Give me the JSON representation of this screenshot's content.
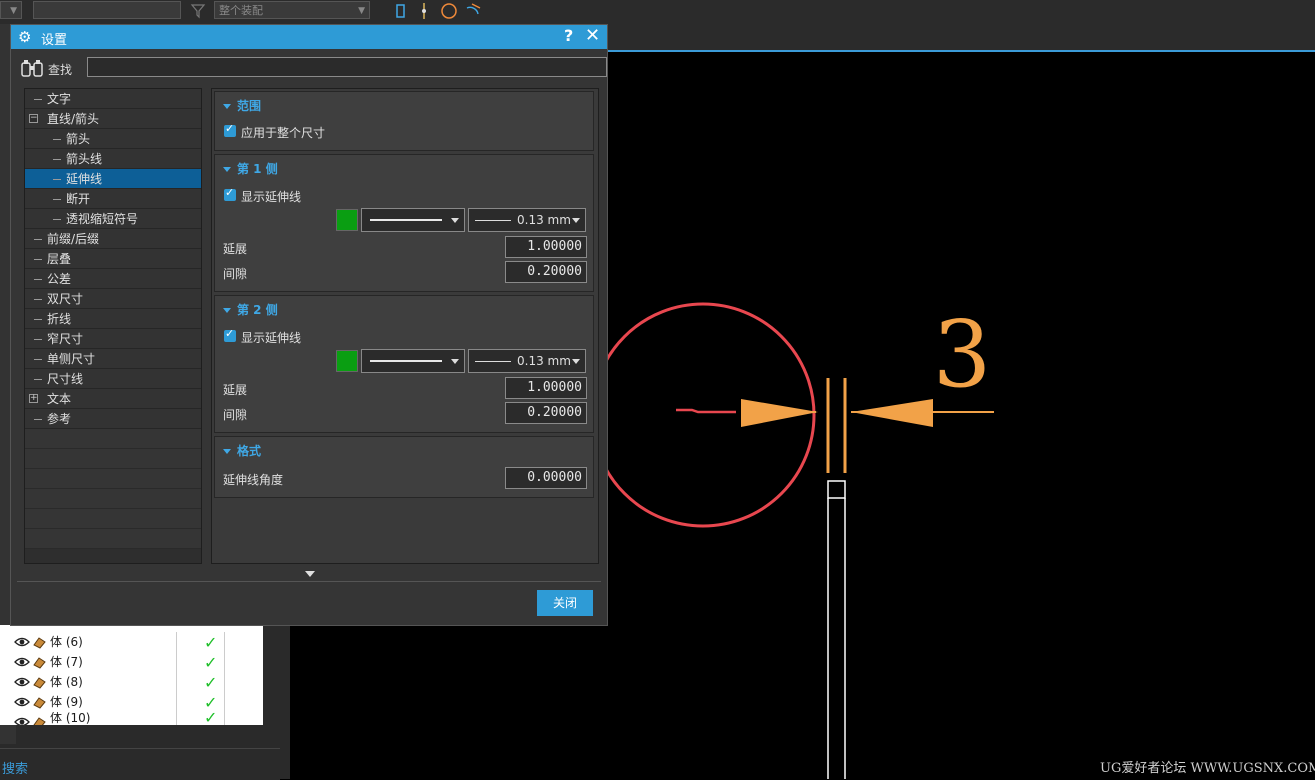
{
  "toolbar": {
    "filter_placeholder": "",
    "assembly_scope": "整个装配"
  },
  "dialog": {
    "title": "设置",
    "help_glyph": "?",
    "close_glyph": "✕",
    "find_label": "查找",
    "find_value": "",
    "close_button": "关闭"
  },
  "tree": [
    {
      "label": "文字",
      "level": 0,
      "expander": "none"
    },
    {
      "label": "直线/箭头",
      "level": 0,
      "expander": "minus"
    },
    {
      "label": "箭头",
      "level": 1,
      "expander": "none"
    },
    {
      "label": "箭头线",
      "level": 1,
      "expander": "none"
    },
    {
      "label": "延伸线",
      "level": 1,
      "expander": "none",
      "selected": true
    },
    {
      "label": "断开",
      "level": 1,
      "expander": "none"
    },
    {
      "label": "透视缩短符号",
      "level": 1,
      "expander": "none"
    },
    {
      "label": "前缀/后缀",
      "level": 0,
      "expander": "none"
    },
    {
      "label": "层叠",
      "level": 0,
      "expander": "none"
    },
    {
      "label": "公差",
      "level": 0,
      "expander": "none"
    },
    {
      "label": "双尺寸",
      "level": 0,
      "expander": "none"
    },
    {
      "label": "折线",
      "level": 0,
      "expander": "none"
    },
    {
      "label": "窄尺寸",
      "level": 0,
      "expander": "none"
    },
    {
      "label": "单侧尺寸",
      "level": 0,
      "expander": "none"
    },
    {
      "label": "尺寸线",
      "level": 0,
      "expander": "none"
    },
    {
      "label": "文本",
      "level": 0,
      "expander": "plus"
    },
    {
      "label": "参考",
      "level": 0,
      "expander": "none"
    }
  ],
  "groups": {
    "scope": {
      "title": "范围",
      "apply_label": "应用于整个尺寸",
      "apply_checked": true
    },
    "side1": {
      "title": "第 1 侧",
      "show_label": "显示延伸线",
      "show_checked": true,
      "color": "#0a9e12",
      "weight": "0.13 mm",
      "extend_label": "延展",
      "extend_value": "1.00000",
      "gap_label": "间隙",
      "gap_value": "0.20000"
    },
    "side2": {
      "title": "第 2 侧",
      "show_label": "显示延伸线",
      "show_checked": true,
      "color": "#0a9e12",
      "weight": "0.13 mm",
      "extend_label": "延展",
      "extend_value": "1.00000",
      "gap_label": "间隙",
      "gap_value": "0.20000"
    },
    "format": {
      "title": "格式",
      "angle_label": "延伸线角度",
      "angle_value": "0.00000"
    }
  },
  "part_list": [
    {
      "label": "体 (6)",
      "visible": true
    },
    {
      "label": "体 (7)",
      "visible": true
    },
    {
      "label": "体 (8)",
      "visible": true
    },
    {
      "label": "体 (9)",
      "visible": true
    },
    {
      "label": "体 (10)",
      "visible": true
    }
  ],
  "bottom": {
    "search_label": "搜索"
  },
  "drawing": {
    "dimension_text": "3",
    "dimension_color": "#f2a248",
    "highlight_color": "#e8474f"
  },
  "watermark": "UG爱好者论坛 WWW.UGSNX.COM"
}
